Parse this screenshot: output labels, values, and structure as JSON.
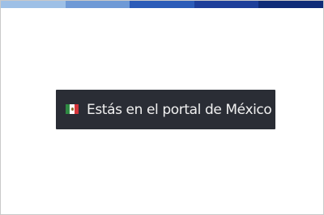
{
  "top_stripe": {
    "colors": [
      "#9ec0e6",
      "#6f9ad6",
      "#2c5cb8",
      "#1e3f9a",
      "#0f2c78"
    ]
  },
  "portal_badge": {
    "flag_icon": "mexico-flag-icon",
    "flag_colors": [
      "#2f8a43",
      "#ffffff",
      "#d5343a"
    ],
    "text": "Estás en el portal de México",
    "background": "#2a2d35"
  }
}
